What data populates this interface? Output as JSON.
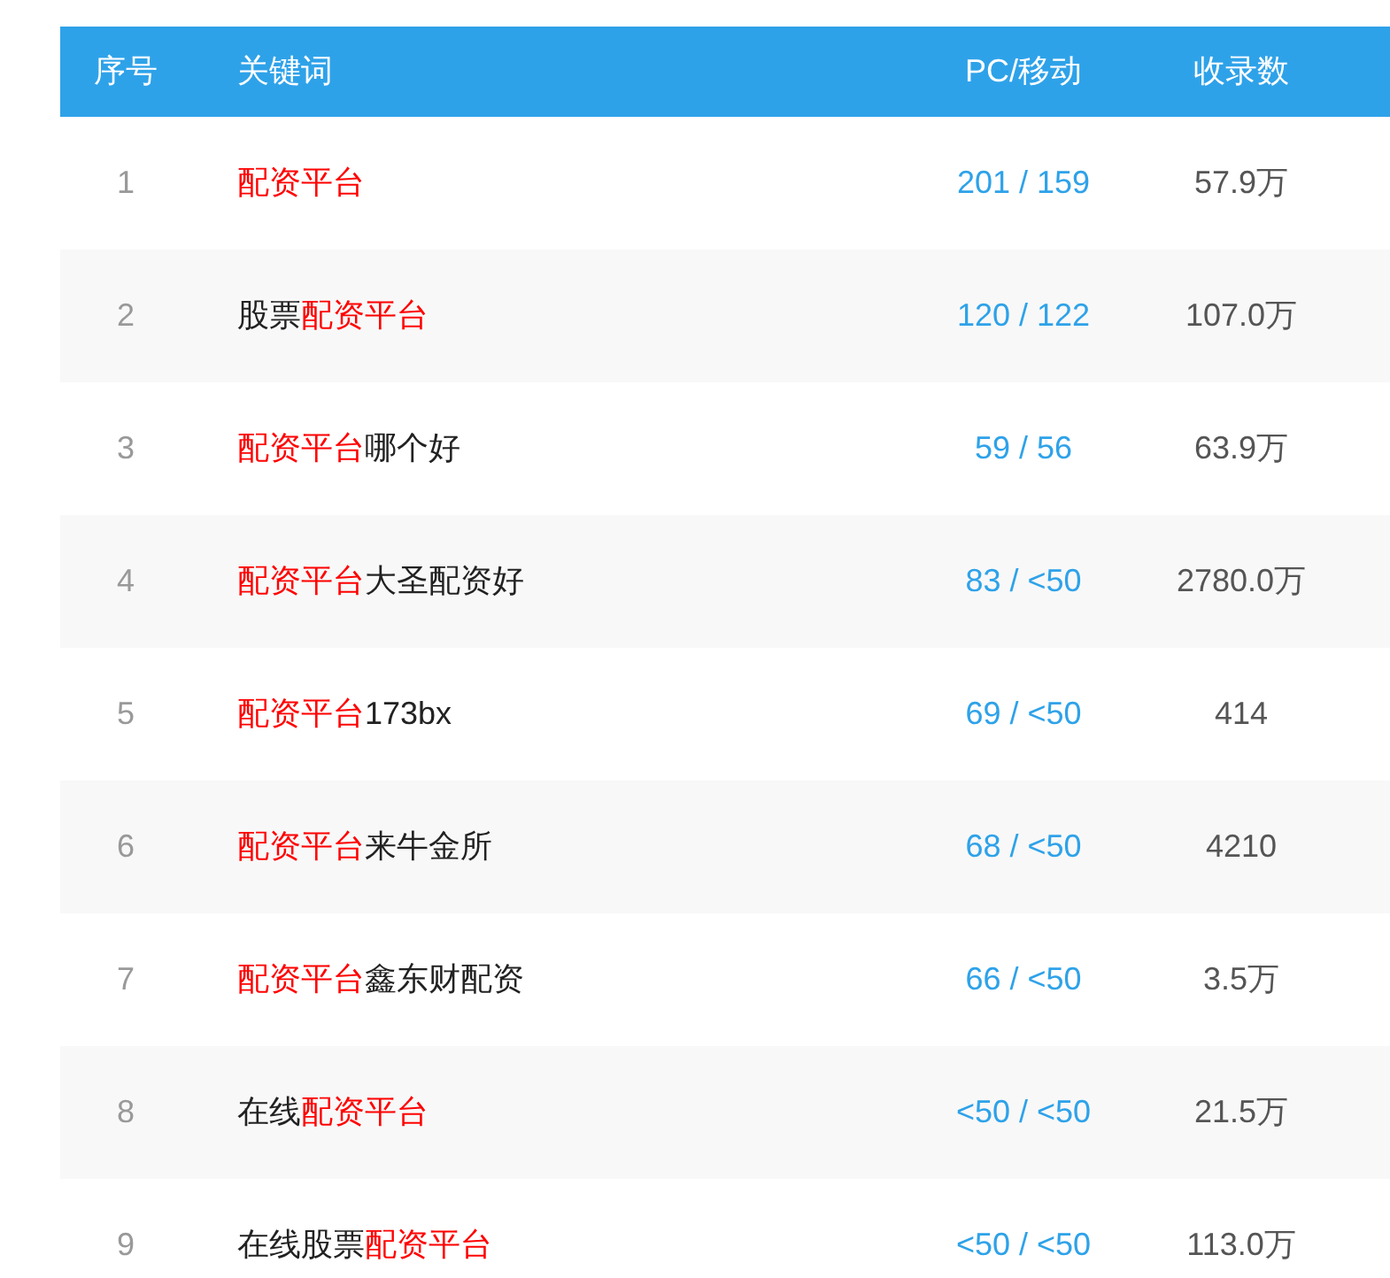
{
  "table": {
    "columns": [
      "序号",
      "关键词",
      "PC/移动",
      "收录数"
    ],
    "rows": [
      {
        "index": "1",
        "keyword": [
          {
            "text": "配资平台",
            "highlight": true
          }
        ],
        "pc_mobile": "201 / 159",
        "count": "57.9万"
      },
      {
        "index": "2",
        "keyword": [
          {
            "text": "股票",
            "highlight": false
          },
          {
            "text": "配资平台",
            "highlight": true
          }
        ],
        "pc_mobile": "120 / 122",
        "count": "107.0万"
      },
      {
        "index": "3",
        "keyword": [
          {
            "text": "配资平台",
            "highlight": true
          },
          {
            "text": "哪个好",
            "highlight": false
          }
        ],
        "pc_mobile": "59 / 56",
        "count": "63.9万"
      },
      {
        "index": "4",
        "keyword": [
          {
            "text": "配资平台",
            "highlight": true
          },
          {
            "text": "大圣配资好",
            "highlight": false
          }
        ],
        "pc_mobile": "83 / <50",
        "count": "2780.0万"
      },
      {
        "index": "5",
        "keyword": [
          {
            "text": "配资平台",
            "highlight": true
          },
          {
            "text": "173bx",
            "highlight": false
          }
        ],
        "pc_mobile": "69 / <50",
        "count": "414"
      },
      {
        "index": "6",
        "keyword": [
          {
            "text": "配资平台",
            "highlight": true
          },
          {
            "text": "来牛金所",
            "highlight": false
          }
        ],
        "pc_mobile": "68 / <50",
        "count": "4210"
      },
      {
        "index": "7",
        "keyword": [
          {
            "text": "配资平台",
            "highlight": true
          },
          {
            "text": "鑫东财配资",
            "highlight": false
          }
        ],
        "pc_mobile": "66 / <50",
        "count": "3.5万"
      },
      {
        "index": "8",
        "keyword": [
          {
            "text": "在线",
            "highlight": false
          },
          {
            "text": "配资平台",
            "highlight": true
          }
        ],
        "pc_mobile": "<50 / <50",
        "count": "21.5万"
      },
      {
        "index": "9",
        "keyword": [
          {
            "text": "在线股票",
            "highlight": false
          },
          {
            "text": "配资平台",
            "highlight": true
          }
        ],
        "pc_mobile": "<50 / <50",
        "count": "113.0万"
      }
    ]
  }
}
